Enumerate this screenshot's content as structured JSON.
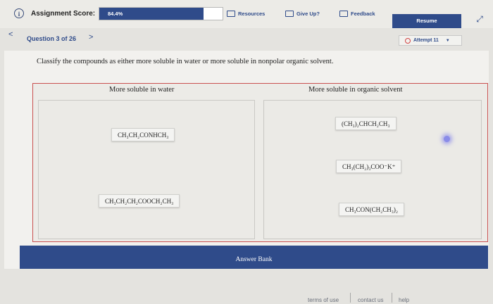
{
  "header": {
    "score_label": "Assignment Score:",
    "score_value": "84.4%",
    "score_fraction": 0.844,
    "resources_label": "Resources",
    "giveup_label": "Give Up?",
    "feedback_label": "Feedback",
    "resume_label": "Resume"
  },
  "nav": {
    "question_label": "Question 3 of 26",
    "attempt_label": "Attempt 11"
  },
  "question": {
    "prompt": "Classify the compounds as either more soluble in water or more soluble in nonpolar organic solvent."
  },
  "columns": {
    "left_heading": "More soluble in water",
    "right_heading": "More soluble in organic solvent"
  },
  "left_cards": [
    {
      "formula": "CH₃CH₂CONHCH₃"
    },
    {
      "formula": "CH₃CH₂CH₂COOCH₂CH₃"
    }
  ],
  "right_cards": [
    {
      "formula": "(CH₃)₂CHCH₂CH₃"
    },
    {
      "formula": "CH₃(CH₂)₃COO⁻K⁺"
    },
    {
      "formula": "CH₃CON(CH₂CH₃)₂"
    }
  ],
  "answer_bank_label": "Answer Bank",
  "footer": {
    "terms_label": "terms of use",
    "contact_label": "contact us",
    "help_label": "help"
  },
  "colors": {
    "brand": "#2f4b8a",
    "board_border": "#c95050",
    "attempt_icon": "#d24444"
  }
}
